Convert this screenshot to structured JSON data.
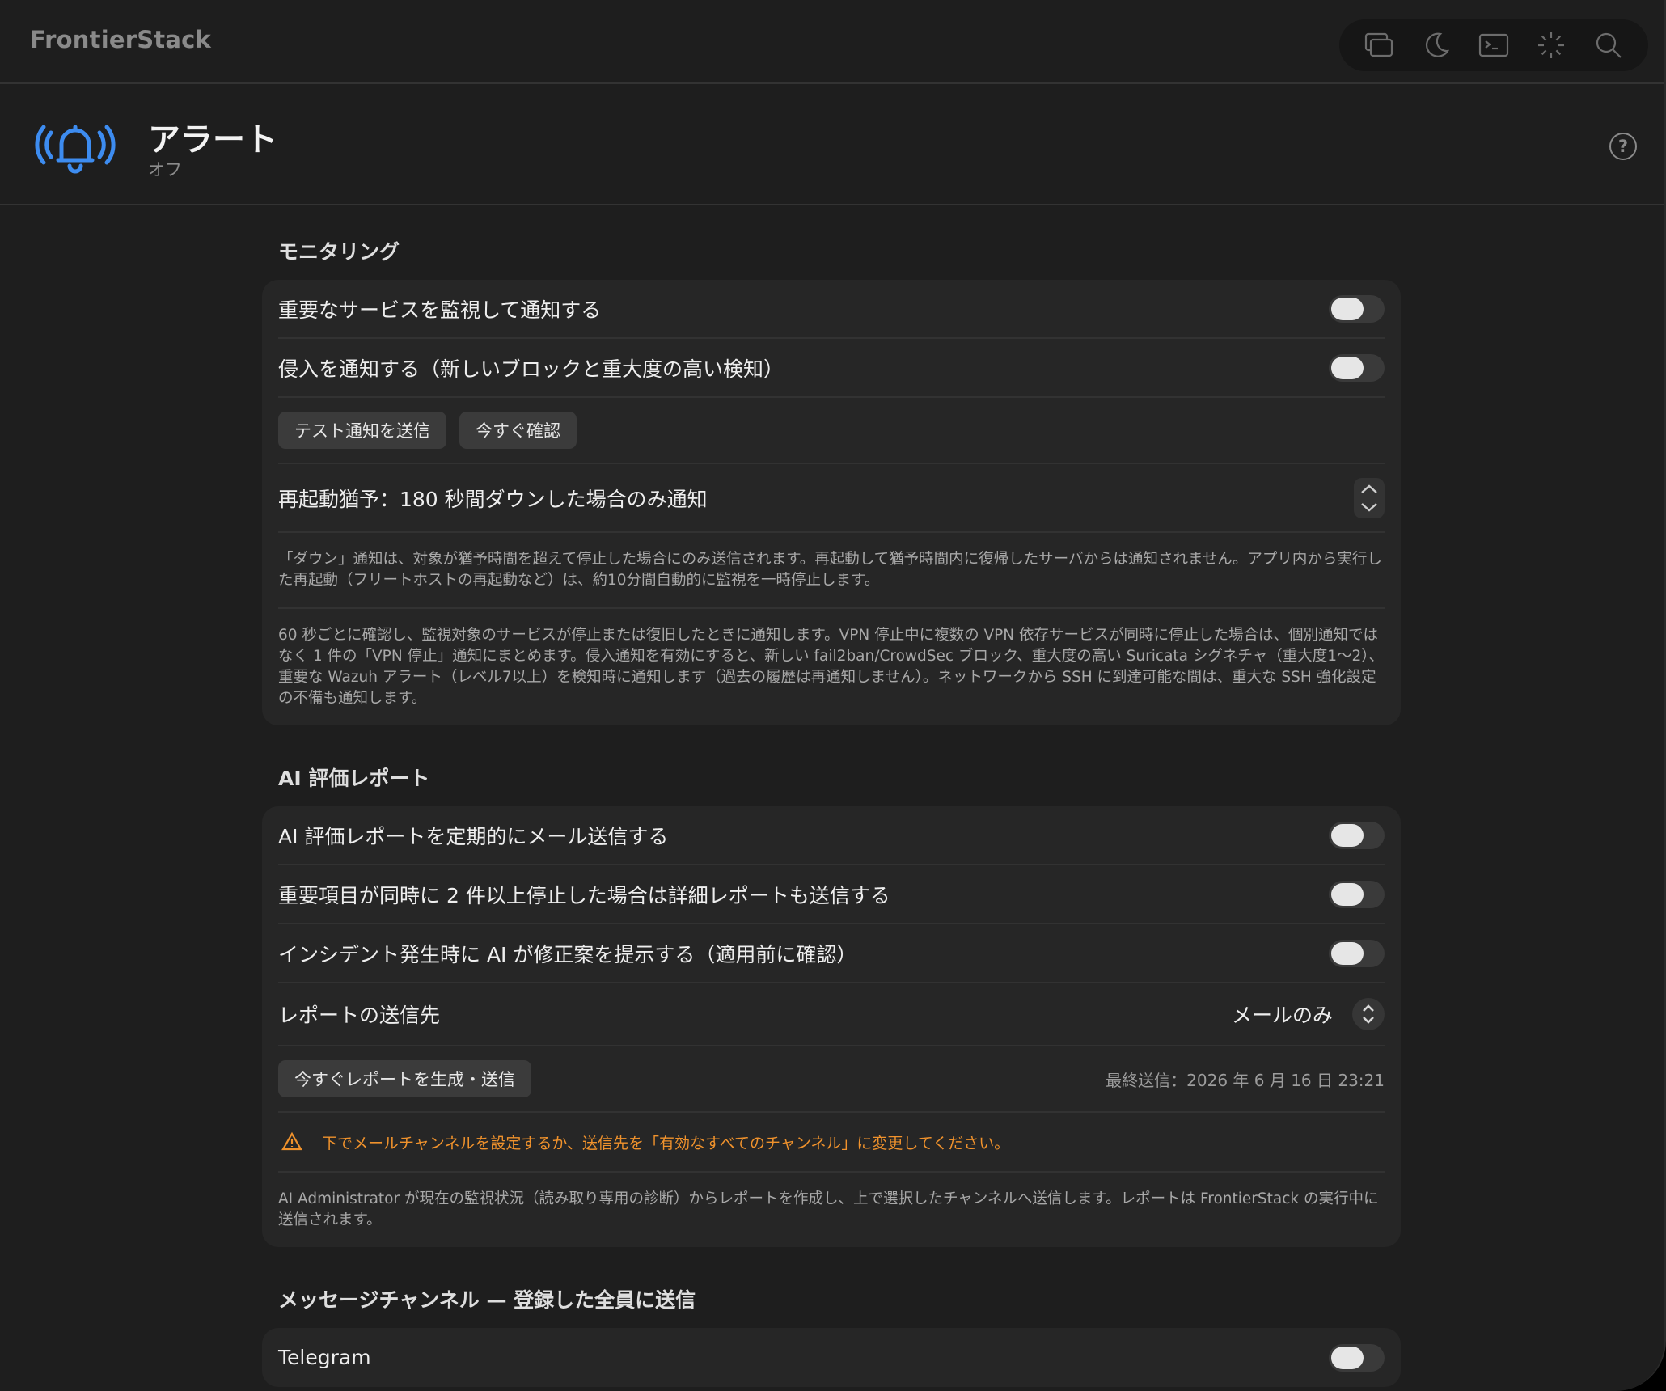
{
  "app": {
    "title": "FrontierStack"
  },
  "toolbar": {
    "icons": [
      "windows-icon",
      "moon-icon",
      "terminal-icon",
      "loading-icon",
      "search-icon"
    ]
  },
  "header": {
    "title": "アラート",
    "subtitle": "オフ",
    "help": "?"
  },
  "monitoring": {
    "title": "モニタリング",
    "service_toggle_label": "重要なサービスを監視して通知する",
    "service_toggle_on": false,
    "intrusion_toggle_label": "侵入を通知する（新しいブロックと重大度の高い検知）",
    "intrusion_toggle_on": false,
    "test_button": "テスト通知を送信",
    "check_button": "今すぐ確認",
    "grace_label": "再起動猶予：180 秒間ダウンした場合のみ通知",
    "note1": "「ダウン」通知は、対象が猶予時間を超えて停止した場合にのみ送信されます。再起動して猶予時間内に復帰したサーバからは通知されません。アプリ内から実行した再起動（フリートホストの再起動など）は、約10分間自動的に監視を一時停止します。",
    "note2": "60 秒ごとに確認し、監視対象のサービスが停止または復旧したときに通知します。VPN 停止中に複数の VPN 依存サービスが同時に停止した場合は、個別通知ではなく 1 件の「VPN 停止」通知にまとめます。侵入通知を有効にすると、新しい fail2ban/CrowdSec ブロック、重大度の高い Suricata シグネチャ（重大度1～2）、重要な Wazuh アラート（レベル7以上）を検知時に通知します（過去の履歴は再通知しません）。ネットワークから SSH に到達可能な間は、重大な SSH 強化設定の不備も通知します。"
  },
  "ai_report": {
    "title": "AI 評価レポート",
    "periodic_label": "AI 評価レポートを定期的にメール送信する",
    "periodic_on": false,
    "detail_label": "重要項目が同時に 2 件以上停止した場合は詳細レポートも送信する",
    "detail_on": false,
    "propose_label": "インシデント発生時に AI が修正案を提示する（適用前に確認）",
    "propose_on": false,
    "destination_label": "レポートの送信先",
    "destination_value": "メールのみ",
    "generate_button": "今すぐレポートを生成・送信",
    "last_sent": "最終送信：2026 年 6 月 16 日 23:21",
    "warning": "下でメールチャンネルを設定するか、送信先を「有効なすべてのチャンネル」に変更してください。",
    "note": "AI Administrator が現在の監視状況（読み取り専用の診断）からレポートを作成し、上で選択したチャンネルへ送信します。レポートは FrontierStack の実行中に送信されます。"
  },
  "channels": {
    "title": "メッセージチャンネル — 登録した全員に送信",
    "telegram_label": "Telegram",
    "telegram_on": false
  }
}
